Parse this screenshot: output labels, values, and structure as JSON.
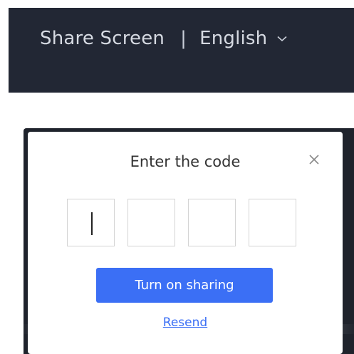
{
  "header": {
    "share_screen_label": "Share Screen",
    "separator": "|",
    "language": "English",
    "chevron_icon": "chevron-down-icon",
    "background_color": "#222734"
  },
  "modal": {
    "title": "Enter the code",
    "close_icon": "close-icon",
    "code_inputs": [
      "",
      "",
      "",
      ""
    ],
    "active_input_index": 0,
    "primary_button_label": "Turn on sharing",
    "resend_label": "Resend",
    "accent_color": "#3b6ff5"
  }
}
